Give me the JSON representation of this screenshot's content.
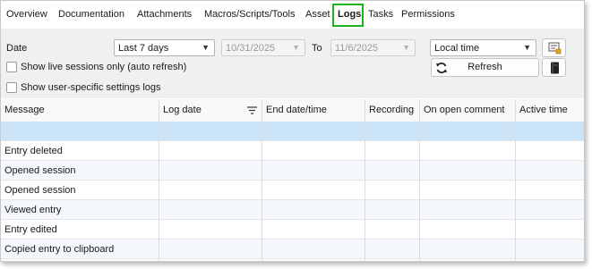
{
  "tabs": [
    {
      "label": "Overview"
    },
    {
      "label": "Documentation"
    },
    {
      "label": "Attachments"
    },
    {
      "label": "Macros/Scripts/Tools"
    },
    {
      "label": "Asset"
    },
    {
      "label": "Logs",
      "active": true
    },
    {
      "label": "Tasks"
    },
    {
      "label": "Permissions"
    }
  ],
  "filters": {
    "date_label": "Date",
    "date_range": "Last 7 days",
    "from_date": "10/31/2025",
    "to_label": "To",
    "to_date": "11/6/2025",
    "timezone": "Local time",
    "live_sessions_label": "Show live sessions only (auto refresh)",
    "user_settings_label": "Show user-specific settings logs",
    "refresh_label": "Refresh"
  },
  "table": {
    "columns": [
      "Message",
      "Log date",
      "End date/time",
      "Recording",
      "On open comment",
      "Active time"
    ],
    "rows": [
      {
        "message": ""
      },
      {
        "message": "Entry deleted"
      },
      {
        "message": "Opened session"
      },
      {
        "message": "Opened session"
      },
      {
        "message": "Viewed entry"
      },
      {
        "message": "Entry edited"
      },
      {
        "message": "Copied entry to clipboard"
      }
    ]
  },
  "icons": {
    "export": "export-icon",
    "refresh": "refresh-icon",
    "book": "book-icon",
    "filter": "filter-icon",
    "chevron": "chevron-down-icon"
  },
  "colors": {
    "active_tab_highlight": "#1db31d",
    "selected_row": "#cce4f7",
    "panel_background": "#f0f0f0"
  }
}
